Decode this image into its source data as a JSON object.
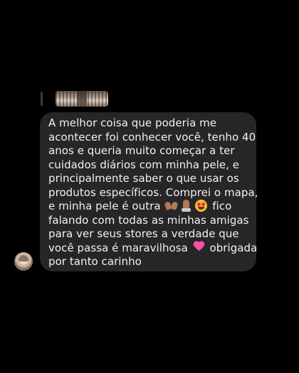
{
  "conversation": {
    "reply_context": {
      "icon": "story-thumbnail"
    },
    "message": {
      "lines": [
        "A melhor coisa que poderia me",
        "acontecer foi conhecer você, tenho 40",
        "anos e queria muito começar a ter",
        "cuidados diários com minha pele, e",
        "principalmente saber o que usar os",
        "produtos específicos. Comprei o mapa,"
      ],
      "line7_before": "e minha pele é outra ",
      "line7_after": " fico",
      "lines_mid": [
        "falando com todas as minhas amigas",
        "para ver seus stores a verdade que"
      ],
      "line10_before": "você passa é maravilhosa ",
      "line10_after": " obrigada",
      "line11": "por tanto carinho",
      "emojis": [
        "heart-hands",
        "folded-hands",
        "heart-eyes",
        "pink-heart"
      ],
      "bubble_color": "#262628",
      "text_color": "#f2f2f2"
    },
    "sender": {
      "avatar": "avatar"
    }
  }
}
